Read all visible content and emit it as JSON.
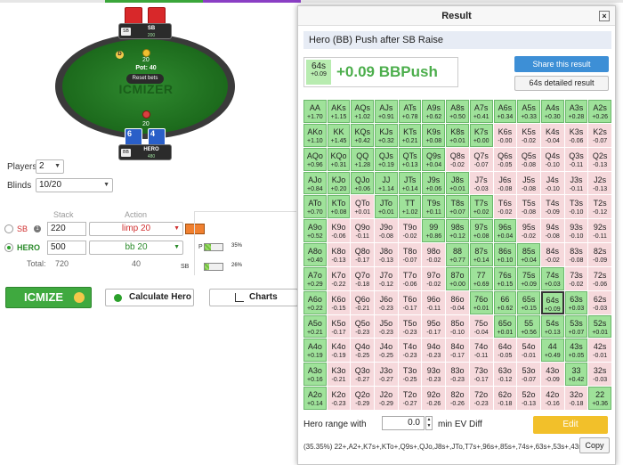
{
  "table": {
    "sb_seat": {
      "position": "SB",
      "name": "SB",
      "stack": "200"
    },
    "hero_seat": {
      "position": "BB",
      "name": "HERO",
      "stack": "480"
    },
    "pot": "Pot: 40",
    "reset": "Reset bets",
    "watermark": "ICMIZER",
    "sb_bet": "20",
    "hero_bet": "20",
    "dealer": "D",
    "hero_cards": [
      "6",
      "4"
    ]
  },
  "settings": {
    "players_label": "Players",
    "players_value": "2",
    "blinds_label": "Blinds",
    "blinds_value": "10/20",
    "stack_header": "Stack",
    "action_header": "Action",
    "sb_label": "SB",
    "sb_stack": "220",
    "sb_action": "limp 20",
    "sb_badge": "1",
    "hero_label": "HERO",
    "hero_stack": "500",
    "hero_action": "bb 20",
    "total_label": "Total:",
    "total_stack": "720",
    "total_action": "40",
    "pos_p": "P",
    "pos_sb": "SB",
    "bar1_pct": "35%",
    "bar2_pct": "26%",
    "bar1_fill": 0.35,
    "bar2_fill": 0.26
  },
  "buttons": {
    "icmize": "ICMIZE",
    "calculate": "Calculate Hero",
    "charts": "Charts"
  },
  "dialog": {
    "title": "Result",
    "close": "×",
    "subtitle": "Hero (BB) Push after SB Raise",
    "hand": "64s",
    "hand_ev": "+0.09",
    "ev_text": "+0.09 BBPush",
    "share": "Share this result",
    "detail": "64s detailed result",
    "hero_range_label": "Hero range with",
    "ev_diff": "0.0",
    "ev_diff_label": "min EV Diff",
    "edit": "Edit",
    "range_text": "(35.35%) 22+,A2+,K7s+,KTo+,Q9s+,QJo,J8s+,JTo,T7s+,96s+,85s+,74s+,63s+,53s+,43s",
    "copy": "Copy"
  },
  "grid": [
    [
      [
        "AA",
        "+1.70",
        "g"
      ],
      [
        "AKs",
        "+1.15",
        "g"
      ],
      [
        "AQs",
        "+1.02",
        "g"
      ],
      [
        "AJs",
        "+0.91",
        "g"
      ],
      [
        "ATs",
        "+0.78",
        "g"
      ],
      [
        "A9s",
        "+0.62",
        "g"
      ],
      [
        "A8s",
        "+0.50",
        "g"
      ],
      [
        "A7s",
        "+0.41",
        "g"
      ],
      [
        "A6s",
        "+0.34",
        "g"
      ],
      [
        "A5s",
        "+0.33",
        "g"
      ],
      [
        "A4s",
        "+0.30",
        "g"
      ],
      [
        "A3s",
        "+0.28",
        "g"
      ],
      [
        "A2s",
        "+0.26",
        "g"
      ]
    ],
    [
      [
        "AKo",
        "+1.10",
        "g"
      ],
      [
        "KK",
        "+1.45",
        "g"
      ],
      [
        "KQs",
        "+0.42",
        "g"
      ],
      [
        "KJs",
        "+0.32",
        "g"
      ],
      [
        "KTs",
        "+0.21",
        "g"
      ],
      [
        "K9s",
        "+0.08",
        "g"
      ],
      [
        "K8s",
        "+0.01",
        "g"
      ],
      [
        "K7s",
        "+0.00",
        "g"
      ],
      [
        "K6s",
        "-0.00",
        "r"
      ],
      [
        "K5s",
        "-0.02",
        "r"
      ],
      [
        "K4s",
        "-0.04",
        "r"
      ],
      [
        "K3s",
        "-0.06",
        "r"
      ],
      [
        "K2s",
        "-0.07",
        "r"
      ]
    ],
    [
      [
        "AQo",
        "+0.96",
        "g"
      ],
      [
        "KQo",
        "+0.31",
        "g"
      ],
      [
        "QQ",
        "+1.28",
        "g"
      ],
      [
        "QJs",
        "+0.19",
        "g"
      ],
      [
        "QTs",
        "+0.13",
        "g"
      ],
      [
        "Q9s",
        "+0.04",
        "g"
      ],
      [
        "Q8s",
        "-0.02",
        "r"
      ],
      [
        "Q7s",
        "-0.07",
        "r"
      ],
      [
        "Q6s",
        "-0.05",
        "r"
      ],
      [
        "Q5s",
        "-0.08",
        "r"
      ],
      [
        "Q4s",
        "-0.10",
        "r"
      ],
      [
        "Q3s",
        "-0.11",
        "r"
      ],
      [
        "Q2s",
        "-0.13",
        "r"
      ]
    ],
    [
      [
        "AJo",
        "+0.84",
        "g"
      ],
      [
        "KJo",
        "+0.20",
        "g"
      ],
      [
        "QJo",
        "+0.06",
        "g"
      ],
      [
        "JJ",
        "+1.14",
        "g"
      ],
      [
        "JTs",
        "+0.14",
        "g"
      ],
      [
        "J9s",
        "+0.06",
        "g"
      ],
      [
        "J8s",
        "+0.01",
        "g"
      ],
      [
        "J7s",
        "-0.03",
        "r"
      ],
      [
        "J6s",
        "-0.08",
        "r"
      ],
      [
        "J5s",
        "-0.08",
        "r"
      ],
      [
        "J4s",
        "-0.10",
        "r"
      ],
      [
        "J3s",
        "-0.11",
        "r"
      ],
      [
        "J2s",
        "-0.13",
        "r"
      ]
    ],
    [
      [
        "ATo",
        "+0.70",
        "g"
      ],
      [
        "KTo",
        "+0.08",
        "g"
      ],
      [
        "QTo",
        "+0.01",
        "r"
      ],
      [
        "JTo",
        "+0.01",
        "g"
      ],
      [
        "TT",
        "+1.02",
        "g"
      ],
      [
        "T9s",
        "+0.11",
        "g"
      ],
      [
        "T8s",
        "+0.07",
        "g"
      ],
      [
        "T7s",
        "+0.02",
        "g"
      ],
      [
        "T6s",
        "-0.02",
        "r"
      ],
      [
        "T5s",
        "-0.08",
        "r"
      ],
      [
        "T4s",
        "-0.09",
        "r"
      ],
      [
        "T3s",
        "-0.10",
        "r"
      ],
      [
        "T2s",
        "-0.12",
        "r"
      ]
    ],
    [
      [
        "A9o",
        "+0.52",
        "g"
      ],
      [
        "K9o",
        "-0.06",
        "r"
      ],
      [
        "Q9o",
        "-0.11",
        "r"
      ],
      [
        "J9o",
        "-0.08",
        "r"
      ],
      [
        "T9o",
        "-0.02",
        "r"
      ],
      [
        "99",
        "+0.86",
        "g"
      ],
      [
        "98s",
        "+0.12",
        "g"
      ],
      [
        "97s",
        "+0.08",
        "g"
      ],
      [
        "96s",
        "+0.04",
        "g"
      ],
      [
        "95s",
        "-0.02",
        "r"
      ],
      [
        "94s",
        "-0.08",
        "r"
      ],
      [
        "93s",
        "-0.10",
        "r"
      ],
      [
        "92s",
        "-0.11",
        "r"
      ]
    ],
    [
      [
        "A8o",
        "+0.40",
        "g"
      ],
      [
        "K8o",
        "-0.13",
        "r"
      ],
      [
        "Q8o",
        "-0.17",
        "r"
      ],
      [
        "J8o",
        "-0.13",
        "r"
      ],
      [
        "T8o",
        "-0.07",
        "r"
      ],
      [
        "98o",
        "-0.02",
        "r"
      ],
      [
        "88",
        "+0.77",
        "g"
      ],
      [
        "87s",
        "+0.14",
        "g"
      ],
      [
        "86s",
        "+0.10",
        "g"
      ],
      [
        "85s",
        "+0.04",
        "g"
      ],
      [
        "84s",
        "-0.02",
        "r"
      ],
      [
        "83s",
        "-0.08",
        "r"
      ],
      [
        "82s",
        "-0.09",
        "r"
      ]
    ],
    [
      [
        "A7o",
        "+0.29",
        "g"
      ],
      [
        "K7o",
        "-0.22",
        "r"
      ],
      [
        "Q7o",
        "-0.18",
        "r"
      ],
      [
        "J7o",
        "-0.12",
        "r"
      ],
      [
        "T7o",
        "-0.06",
        "r"
      ],
      [
        "97o",
        "-0.02",
        "r"
      ],
      [
        "87o",
        "+0.00",
        "g"
      ],
      [
        "77",
        "+0.69",
        "g"
      ],
      [
        "76s",
        "+0.15",
        "g"
      ],
      [
        "75s",
        "+0.09",
        "g"
      ],
      [
        "74s",
        "+0.03",
        "g"
      ],
      [
        "73s",
        "-0.02",
        "r"
      ],
      [
        "72s",
        "-0.06",
        "r"
      ]
    ],
    [
      [
        "A6o",
        "+0.22",
        "g"
      ],
      [
        "K6o",
        "-0.15",
        "r"
      ],
      [
        "Q6o",
        "-0.21",
        "r"
      ],
      [
        "J6o",
        "-0.23",
        "r"
      ],
      [
        "T6o",
        "-0.17",
        "r"
      ],
      [
        "96o",
        "-0.11",
        "r"
      ],
      [
        "86o",
        "-0.04",
        "r"
      ],
      [
        "76o",
        "+0.01",
        "g"
      ],
      [
        "66",
        "+0.62",
        "g"
      ],
      [
        "65s",
        "+0.15",
        "g"
      ],
      [
        "64s",
        "+0.09",
        "g"
      ],
      [
        "63s",
        "+0.03",
        "g"
      ],
      [
        "62s",
        "-0.03",
        "r"
      ]
    ],
    [
      [
        "A5o",
        "+0.21",
        "g"
      ],
      [
        "K5o",
        "-0.17",
        "r"
      ],
      [
        "Q5o",
        "-0.23",
        "r"
      ],
      [
        "J5o",
        "-0.23",
        "r"
      ],
      [
        "T5o",
        "-0.23",
        "r"
      ],
      [
        "95o",
        "-0.17",
        "r"
      ],
      [
        "85o",
        "-0.10",
        "r"
      ],
      [
        "75o",
        "-0.04",
        "r"
      ],
      [
        "65o",
        "+0.01",
        "g"
      ],
      [
        "55",
        "+0.56",
        "g"
      ],
      [
        "54s",
        "+0.13",
        "g"
      ],
      [
        "53s",
        "+0.07",
        "g"
      ],
      [
        "52s",
        "+0.01",
        "g"
      ]
    ],
    [
      [
        "A4o",
        "+0.19",
        "g"
      ],
      [
        "K4o",
        "-0.19",
        "r"
      ],
      [
        "Q4o",
        "-0.25",
        "r"
      ],
      [
        "J4o",
        "-0.25",
        "r"
      ],
      [
        "T4o",
        "-0.23",
        "r"
      ],
      [
        "94o",
        "-0.23",
        "r"
      ],
      [
        "84o",
        "-0.17",
        "r"
      ],
      [
        "74o",
        "-0.11",
        "r"
      ],
      [
        "64o",
        "-0.05",
        "r"
      ],
      [
        "54o",
        "-0.01",
        "r"
      ],
      [
        "44",
        "+0.49",
        "g"
      ],
      [
        "43s",
        "+0.05",
        "g"
      ],
      [
        "42s",
        "-0.01",
        "r"
      ]
    ],
    [
      [
        "A3o",
        "+0.16",
        "g"
      ],
      [
        "K3o",
        "-0.21",
        "r"
      ],
      [
        "Q3o",
        "-0.27",
        "r"
      ],
      [
        "J3o",
        "-0.27",
        "r"
      ],
      [
        "T3o",
        "-0.25",
        "r"
      ],
      [
        "93o",
        "-0.23",
        "r"
      ],
      [
        "83o",
        "-0.23",
        "r"
      ],
      [
        "73o",
        "-0.17",
        "r"
      ],
      [
        "63o",
        "-0.12",
        "r"
      ],
      [
        "53o",
        "-0.07",
        "r"
      ],
      [
        "43o",
        "-0.09",
        "r"
      ],
      [
        "33",
        "+0.42",
        "g"
      ],
      [
        "32s",
        "-0.03",
        "r"
      ]
    ],
    [
      [
        "A2o",
        "+0.14",
        "g"
      ],
      [
        "K2o",
        "-0.23",
        "r"
      ],
      [
        "Q2o",
        "-0.29",
        "r"
      ],
      [
        "J2o",
        "-0.29",
        "r"
      ],
      [
        "T2o",
        "-0.27",
        "r"
      ],
      [
        "92o",
        "-0.26",
        "r"
      ],
      [
        "82o",
        "-0.26",
        "r"
      ],
      [
        "72o",
        "-0.23",
        "r"
      ],
      [
        "62o",
        "-0.18",
        "r"
      ],
      [
        "52o",
        "-0.13",
        "r"
      ],
      [
        "42o",
        "-0.16",
        "r"
      ],
      [
        "32o",
        "-0.18",
        "r"
      ],
      [
        "22",
        "+0.36",
        "g"
      ]
    ]
  ]
}
